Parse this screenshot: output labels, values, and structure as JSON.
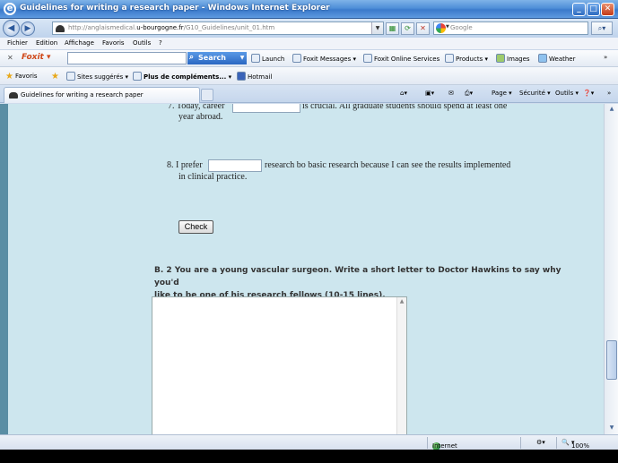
{
  "window": {
    "title": "Guidelines for writing a research paper - Windows Internet Explorer",
    "controls": {
      "minimize": "_",
      "maximize": "□",
      "close": "✕"
    }
  },
  "address_bar": {
    "url_prefix": "http://anglaismedical.",
    "url_domain": "u-bourgogne.fr",
    "url_suffix": "/G10_Guidelines/unit_01.htm",
    "search_placeholder": "Google"
  },
  "menu": [
    "Fichier",
    "Edition",
    "Affichage",
    "Favoris",
    "Outils",
    "?"
  ],
  "foxit_toolbar": {
    "logo": "Foxit ▾",
    "search_button": "Search",
    "items": [
      "Launch",
      "Foxit Messages ▾",
      "Foxit Online Services",
      "Products ▾",
      "Images",
      "Weather"
    ]
  },
  "favorites_bar": {
    "favorites": "Favoris",
    "suggested": "Sites suggérés ▾",
    "addons": "Plus de compléments... ▾",
    "hotmail": "Hotmail"
  },
  "tab": {
    "label": "Guidelines for writing a research paper"
  },
  "command_bar": [
    "Page ▾",
    "Sécurité ▾",
    "Outils ▾"
  ],
  "content": {
    "q7_part1": "7.  Today, career",
    "q7_part2": "is crucial. All graduate students should spend at least one",
    "q7_line2": "year abroad.",
    "q8_part1": "8.  I prefer",
    "q8_part2": "research bo basic research because I can see the results implemented",
    "q8_line2": "in clinical practice.",
    "check_button": "Check",
    "b2_line1": "B. 2 You are a young vascular surgeon. Write a short letter to Doctor Hawkins to say why you'd",
    "b2_line2": "like to be one of his research fellows (10-15 lines)."
  },
  "status_bar": {
    "zone": "Internet",
    "zoom": "100%"
  },
  "colors": {
    "content_bg": "#cde6ee",
    "left_stripe": "#5a8ea4",
    "titlebar": "#3b7acb"
  }
}
